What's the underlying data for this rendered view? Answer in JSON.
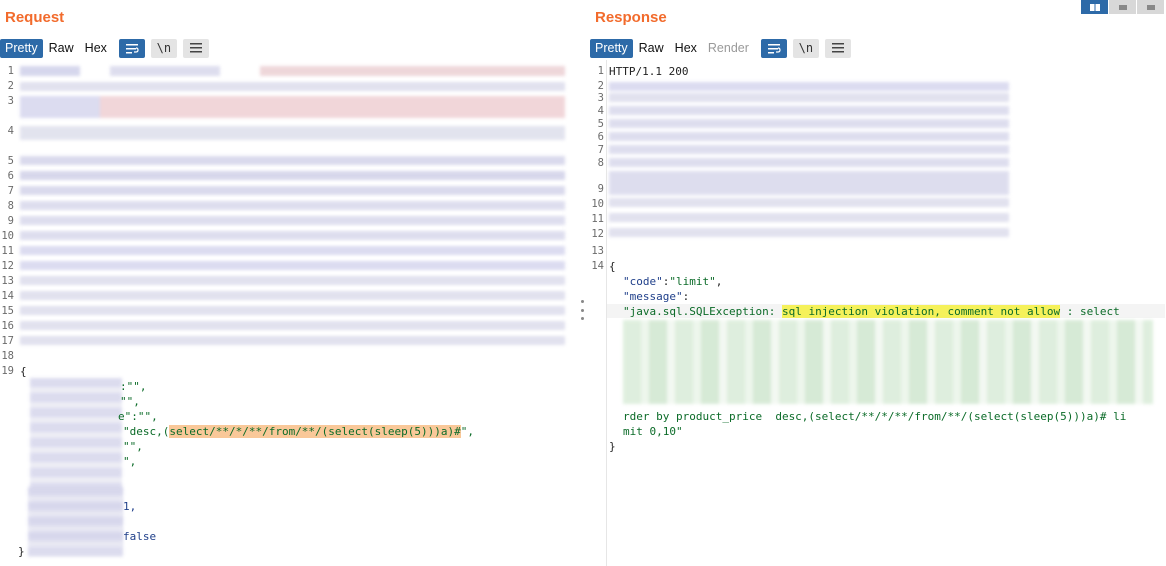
{
  "request": {
    "title": "Request",
    "tabs": [
      "Pretty",
      "Raw",
      "Hex"
    ],
    "active_tab": "Pretty",
    "newline_label": "\\n",
    "line_numbers": [
      "1",
      "2",
      "3",
      "4",
      "5",
      "6",
      "7",
      "8",
      "9",
      "10",
      "11",
      "12",
      "13",
      "14",
      "15",
      "16",
      "17",
      "18",
      "19"
    ],
    "body_open": "{",
    "body_close": "}",
    "visible_fragments": [
      ":\"\",",
      "\"\",",
      "e\":\"\",",
      "\"desc,(",
      "select/**/*/**/from/**/(select(sleep(5)))a)#",
      "\",",
      "\"\",",
      "\",",
      "1,",
      "false"
    ]
  },
  "response": {
    "title": "Response",
    "tabs": [
      "Pretty",
      "Raw",
      "Hex",
      "Render"
    ],
    "active_tab": "Pretty",
    "disabled_tab": "Render",
    "newline_label": "\\n",
    "line_numbers": [
      "1",
      "2",
      "3",
      "4",
      "5",
      "6",
      "7",
      "8",
      "9",
      "10",
      "11",
      "12",
      "13",
      "14"
    ],
    "status_line": "HTTP/1.1 200",
    "body_open": "{",
    "code_key": "\"code\"",
    "code_value": "\"limit\"",
    "message_key": "\"message\"",
    "message_prefix": "\"java.sql.SQLException: ",
    "message_highlight": "sql injection violation, comment not allow",
    "message_after": " : select",
    "message_tail1": "rder by product_price  desc,(select/**/*/**/from/**/(select(sleep(5)))a)# li",
    "message_tail2": "mit 0,10\"",
    "body_close": "}"
  },
  "colors": {
    "accent": "#f26b2c",
    "active_tab": "#2d6aa8",
    "string": "#0b6b28",
    "highlight_payload": "#f9c899",
    "highlight_message": "#f5f15a"
  }
}
